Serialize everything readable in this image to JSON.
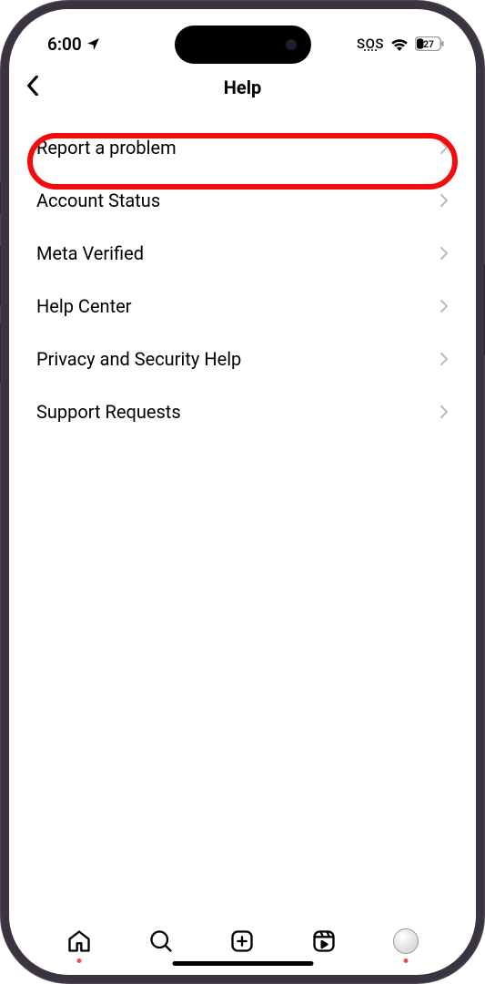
{
  "status": {
    "time": "6:00",
    "sos": "SOS",
    "battery": "27"
  },
  "nav": {
    "title": "Help"
  },
  "menu": {
    "items": [
      {
        "label": "Report a problem"
      },
      {
        "label": "Account Status"
      },
      {
        "label": "Meta Verified"
      },
      {
        "label": "Help Center"
      },
      {
        "label": "Privacy and Security Help"
      },
      {
        "label": "Support Requests"
      }
    ]
  }
}
